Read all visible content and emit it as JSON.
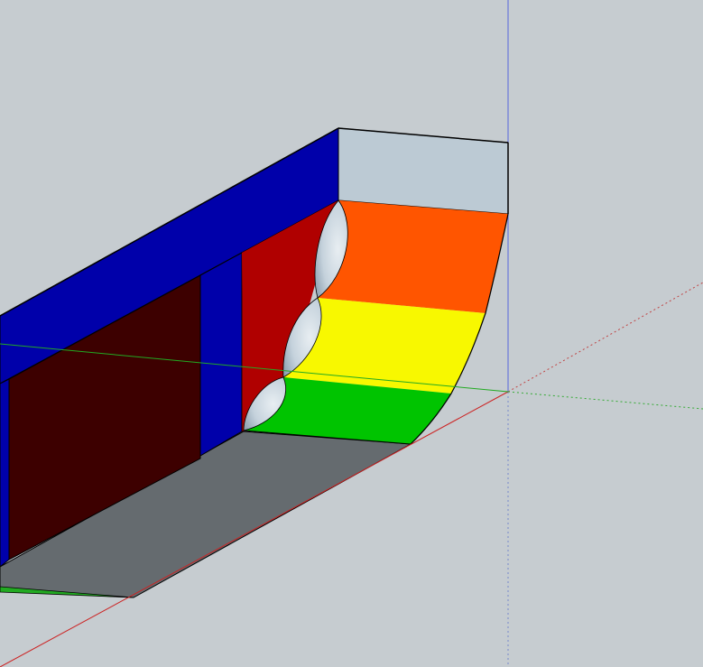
{
  "app": {
    "window_kind": "3D modeling viewport (SketchUp-style)",
    "texts_visible": []
  },
  "scene": {
    "background_color": "#c6ccd0",
    "axes": {
      "red_axis_color": "#cc2222",
      "green_axis_color": "#22aa22",
      "blue_axis_color": "#5566dd"
    },
    "model": {
      "description_colors": {
        "blue_faces": "#0000aa",
        "top_cap": "#bccad4",
        "orange_band": "#ff5500",
        "yellow_band": "#f8f800",
        "green_band": "#00c400",
        "gray_bottom": "#656b6f",
        "dark_red_face": "#3d0000",
        "red_face": "#b00000",
        "cutouts": "#c5d2dc",
        "edge_stroke": "#000000"
      }
    }
  }
}
